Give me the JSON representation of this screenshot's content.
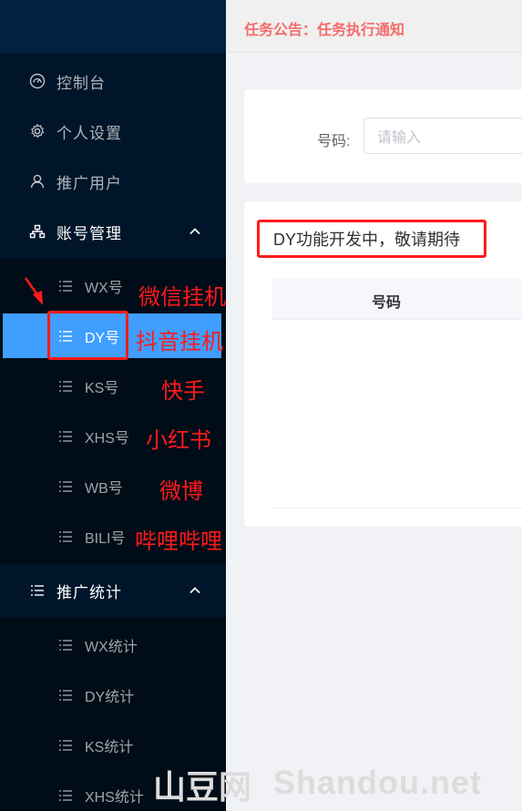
{
  "header": {
    "notice": "任务公告：任务执行通知"
  },
  "sidebar": {
    "menu": [
      {
        "label": "控制台",
        "icon": "dashboard-icon"
      },
      {
        "label": "个人设置",
        "icon": "gear-icon"
      },
      {
        "label": "推广用户",
        "icon": "user-icon"
      },
      {
        "label": "账号管理",
        "icon": "sitemap-icon",
        "expanded": true,
        "children": [
          "WX号",
          "DY号",
          "KS号",
          "XHS号",
          "WB号",
          "BILI号"
        ],
        "active": "DY号"
      },
      {
        "label": "推广统计",
        "icon": "list-icon",
        "expanded": true,
        "children": [
          "WX统计",
          "DY统计",
          "KS统计",
          "XHS统计"
        ]
      }
    ]
  },
  "search": {
    "label": "号码:",
    "placeholder": "请输入"
  },
  "table": {
    "notice": "DY功能开发中，敬请期待",
    "column": "号码"
  },
  "annotations": [
    "微信挂机",
    "抖音挂机",
    "快手",
    "小红书",
    "微博",
    "哔哩哔哩"
  ],
  "watermark": {
    "cn": "山豆网",
    "en": "Shandou.net"
  },
  "colors": {
    "sidebar": "#001529",
    "active": "#409eff",
    "notice": "#f56c6c",
    "annotation": "#ff1a1a"
  }
}
